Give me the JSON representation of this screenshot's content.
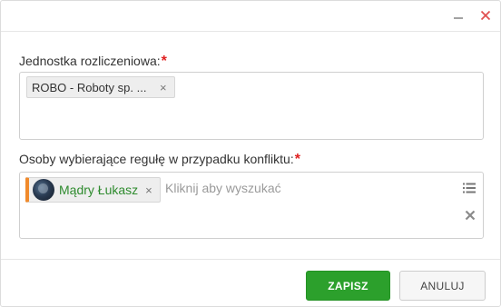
{
  "window": {
    "minimize_icon": "minimize-icon",
    "close_icon": "close-icon",
    "close_color": "#e05050"
  },
  "field1": {
    "label": "Jednostka rozliczeniowa:",
    "required_mark": "*",
    "chip": {
      "text": "ROBO - Roboty sp. ...",
      "remove": "×"
    }
  },
  "field2": {
    "label": "Osoby wybierające regułę w przypadku konfliktu:",
    "required_mark": "*",
    "chip": {
      "text": "Mądry Łukasz",
      "remove": "×",
      "accent_color": "#f08a2c",
      "text_color": "#2e8b2e"
    },
    "placeholder": "Kliknij aby wyszukać",
    "list_icon": "list-icon",
    "clear_icon": "clear-icon"
  },
  "footer": {
    "save_label": "ZAPISZ",
    "cancel_label": "ANULUJ",
    "save_color": "#2ca02c"
  }
}
